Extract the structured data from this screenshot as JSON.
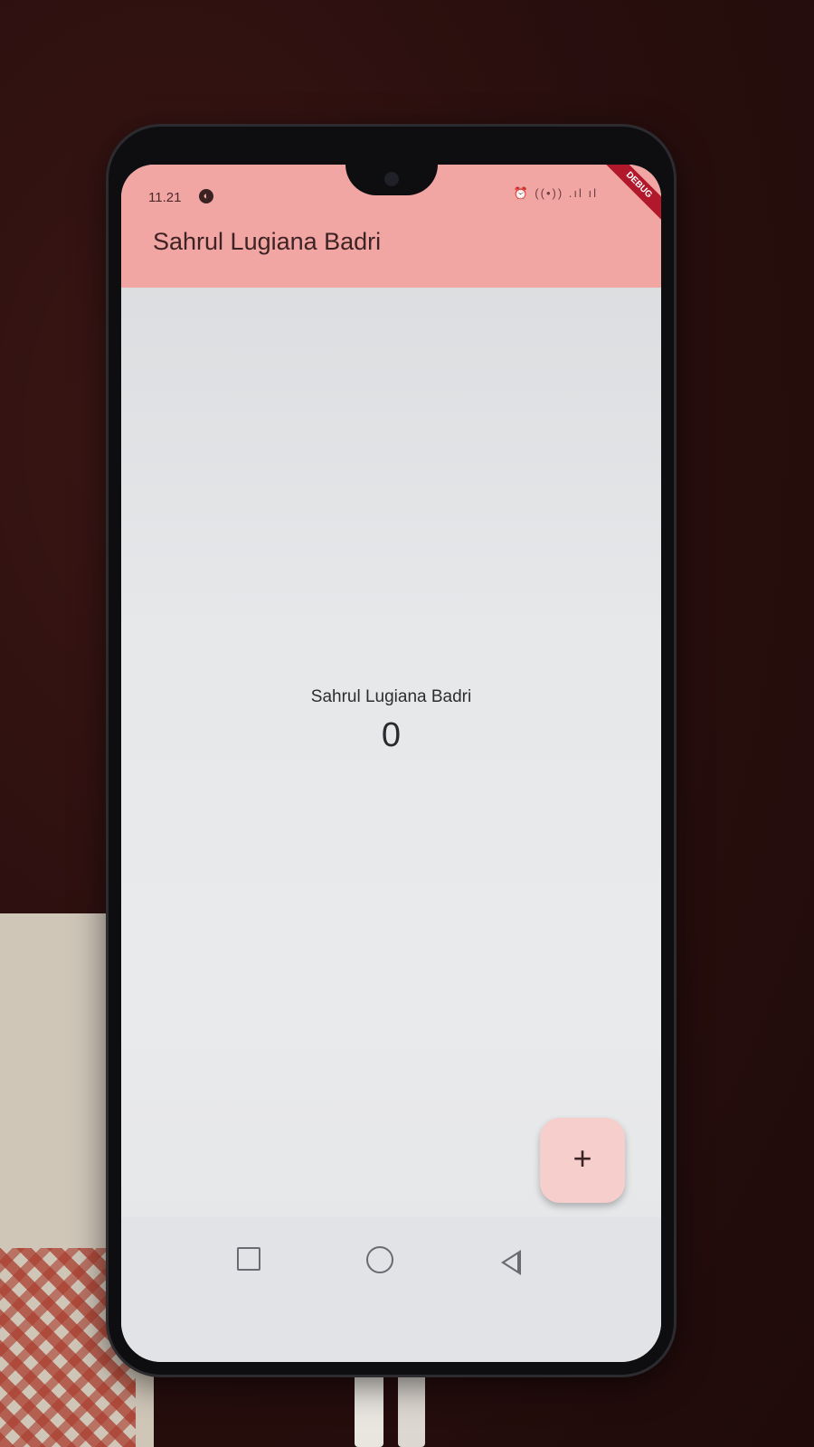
{
  "status_bar": {
    "time": "11.21",
    "icons": "⏰ ((•)) .ıl ıl"
  },
  "debug_banner": "DEBUG",
  "app_bar": {
    "title": "Sahrul Lugiana Badri"
  },
  "main": {
    "label": "Sahrul Lugiana Badri",
    "counter": "0"
  },
  "fab": {
    "icon": "plus-icon",
    "label": "+"
  },
  "nav_bar": {
    "items": [
      "recent-apps-icon",
      "home-icon",
      "back-icon"
    ]
  },
  "colors": {
    "app_bar": "#f1a6a4",
    "fab": "#f6cfcd",
    "debug_banner": "#b2182b"
  }
}
